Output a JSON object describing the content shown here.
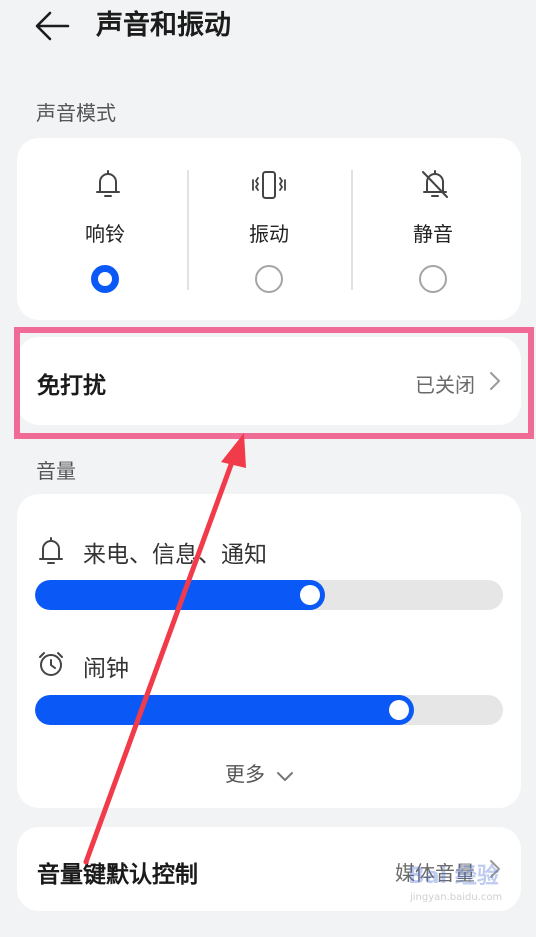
{
  "header": {
    "title": "声音和振动",
    "back_icon": "arrow-left-icon"
  },
  "sound_mode": {
    "section_label": "声音模式",
    "options": [
      {
        "label": "响铃",
        "icon": "bell-icon",
        "selected": true
      },
      {
        "label": "振动",
        "icon": "vibrate-icon",
        "selected": false
      },
      {
        "label": "静音",
        "icon": "bell-off-icon",
        "selected": false
      }
    ]
  },
  "dnd": {
    "label": "免打扰",
    "value": "已关闭"
  },
  "volume": {
    "section_label": "音量",
    "sliders": [
      {
        "label": "来电、信息、通知",
        "icon": "bell-icon",
        "level": 0.62
      },
      {
        "label": "闹钟",
        "icon": "alarm-clock-icon",
        "level": 0.81
      }
    ],
    "more_label": "更多"
  },
  "volume_key": {
    "label": "音量键默认控制",
    "value": "媒体音量"
  },
  "watermark": {
    "text": "Bai 经验",
    "subtext": "jingyan.baidu.com"
  },
  "colors": {
    "accent": "#0a59f7",
    "highlight_border": "#f06b96",
    "arrow": "#f23b4a",
    "background": "#f1f3f5"
  }
}
